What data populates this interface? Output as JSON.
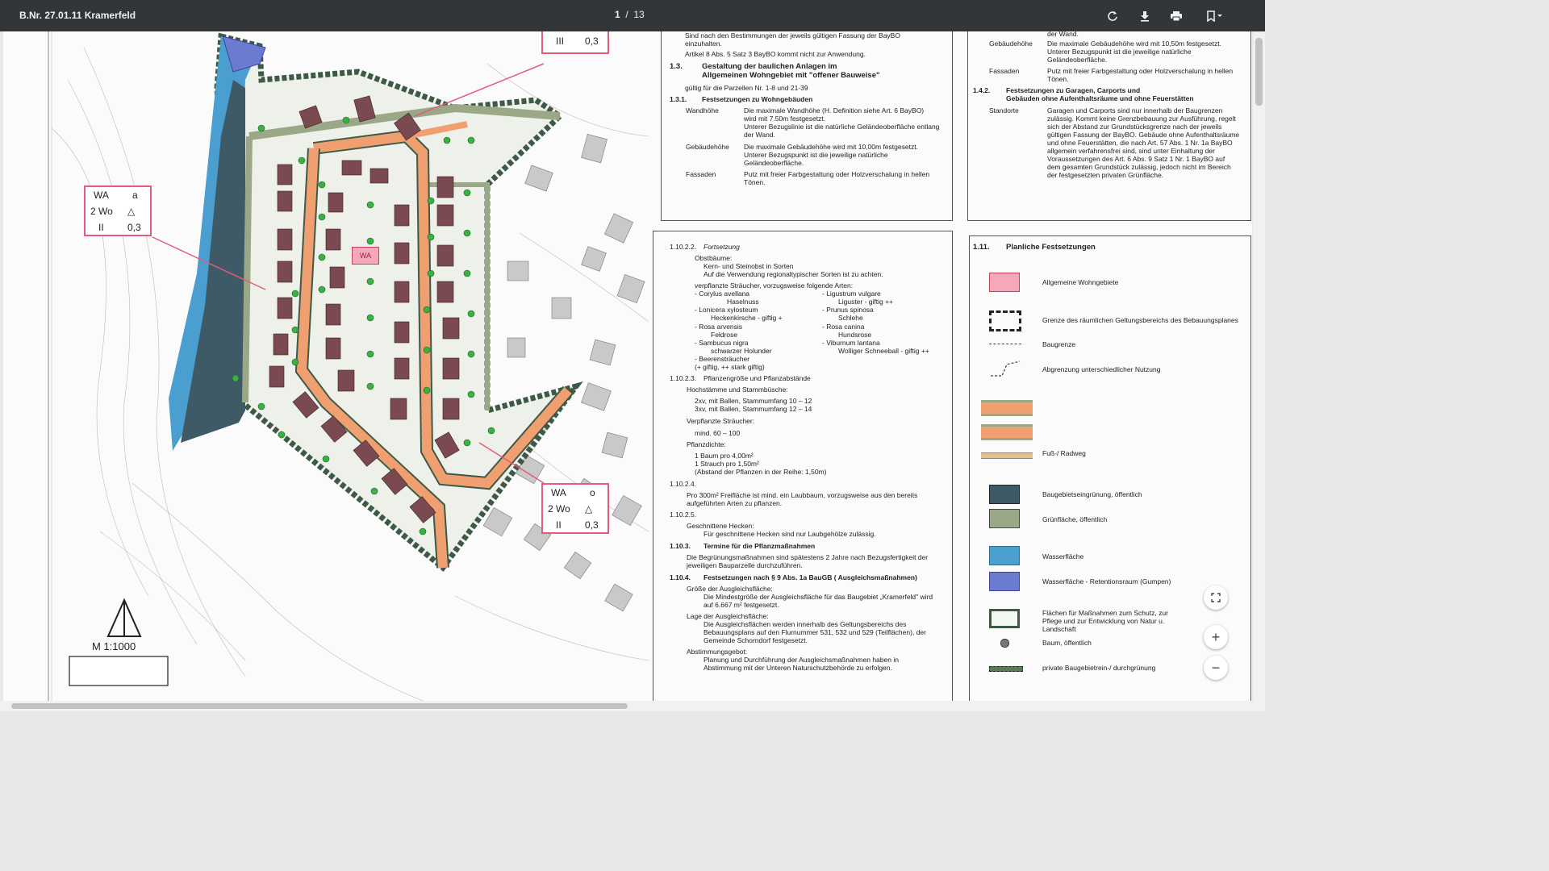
{
  "toolbar": {
    "title": "B.Nr. 27.01.11 Kramerfeld",
    "page_current": "1",
    "page_sep": "/",
    "page_total": "13",
    "icons": [
      "rotate-icon",
      "download-icon",
      "print-icon",
      "bookmark-icon"
    ]
  },
  "map": {
    "tables": [
      {
        "r1a": "WA",
        "r1b": "a",
        "r2a": "2 Wo",
        "r3a": "II",
        "r3b": "0,3"
      },
      {
        "r1a": "WA",
        "r1b": "o",
        "r2a": "2 Wo",
        "r3a": "II",
        "r3b": "0,3"
      },
      {
        "r3a": "III",
        "r3b": "0,3"
      }
    ],
    "scale": "M 1:1000",
    "center_label": "WA"
  },
  "text_top": {
    "l1": "Sind nach den Bestimmungen der jeweils gültigen Fassung der BayBO",
    "l2": "einzuhalten.",
    "l3": "Artikel 8 Abs. 5 Satz 3 BayBO kommt nicht zur Anwendung.",
    "h13_num": "1.3.",
    "h13_a": "Gestaltung der baulichen Anlagen im",
    "h13_b": "Allgemeinen Wohngebiet mit \"offener Bauweise\"",
    "gilt": "gültig für die Parzellen Nr. 1-8 und 21-39",
    "h131_num": "1.3.1.",
    "h131": "Festsetzungen zu Wohngebäuden",
    "wand_k": "Wandhöhe",
    "wand_1": "Die maximale Wandhöhe (H. Definition siehe Art. 6 BayBO)",
    "wand_2": "wird mit 7.50m festgesetzt.",
    "wand_3": "Unterer Bezugslinie ist die natürliche Geländeoberfläche entlang",
    "wand_4": "der Wand.",
    "geb_k": "Gebäudehöhe",
    "geb_1": "Die maximale Gebäudehöhe wird mit 10,00m festgesetzt.",
    "geb_2": "Unterer Bezugspunkt ist die jeweilige natürliche",
    "geb_3": "Geländeoberfläche.",
    "fas_k": "Fassaden",
    "fas_1": "Putz mit freier Farbgestaltung oder Holzverschalung in hellen",
    "fas_2": "Tönen."
  },
  "text_right_top": {
    "l0": "der Wand.",
    "geb_k": "Gebäudehöhe",
    "geb_1": "Die maximale Gebäudehöhe wird mit 10,50m festgesetzt.",
    "geb_2": "Unterer Bezugspunkt ist die jeweilige natürliche",
    "geb_3": "Geländeoberfläche.",
    "fas_k": "Fassaden",
    "fas_1": "Putz mit freier Farbgestaltung oder Holzverschalung in hellen",
    "fas_2": "Tönen.",
    "h142_num": "1.4.2.",
    "h142_a": "Festsetzungen zu Garagen, Carports und",
    "h142_b": "Gebäuden ohne Aufenthaltsräume und ohne Feuerstätten",
    "st_k": "Standorte",
    "st_1": "Garagen und Carports sind nur innerhalb der Baugrenzen",
    "st_2": "zulässig. Kommt keine Grenzbebauung zur Ausführung, regelt",
    "st_3": "sich der Abstand zur Grundstücksgrenze nach der jeweils",
    "st_4": "gültigen Fassung der BayBO. Gebäude ohne Aufenthaltsräume",
    "st_5": "und ohne Feuerstätten, die nach Art. 57 Abs. 1 Nr. 1a BayBO",
    "st_6": "allgemein verfahrensfrei sind, sind unter Einhaltung der",
    "st_7": "Voraussetzungen des Art. 6 Abs. 9 Satz 1 Nr. 1 BayBO auf",
    "st_8": "dem gesamten Grundstück zulässig, jedoch nicht im Bereich",
    "st_9": "der festgesetzten privaten Grünfläche."
  },
  "text_mid": {
    "h1_num": "1.10.2.2.",
    "h1": "Fortsetzung",
    "obst": "Obstbäume:",
    "obst_1": "Kern- und Steinobst in Sorten",
    "obst_2": "Auf die Verwendung regionaltypischer Sorten ist zu achten.",
    "str": "verpflanzte Sträucher, vorzugsweise folgende Arten:",
    "c1": "- Corylus avellana",
    "c1b": "Haselnuss",
    "c2": "- Lonicera xylosteum",
    "c2b": "Heckenkirsche - giftig +",
    "c3": "- Rosa arvensis",
    "c3b": "Feldrose",
    "c4": "- Sambucus nigra",
    "c4b": "schwarzer Holunder",
    "c5": "- Beerensträucher",
    "c5b": "(+ giftig, ++ stark giftig)",
    "d1": "- Ligustrum vulgare",
    "d1b": "Liguster - giftig ++",
    "d2": "- Prunus spinosa",
    "d2b": "Schlehe",
    "d3": "- Rosa canina",
    "d3b": "Hundsrose",
    "d4": "- Viburnum lantana",
    "d4b": "Wolliger Schneeball - giftig ++",
    "h2_num": "1.10.2.3.",
    "h2": "Pflanzengröße und Pflanzabstände",
    "hoch": "Hochstämme und Stammbüsche:",
    "hoch_1": "2xv, mit Ballen, Stammumfang 10 – 12",
    "hoch_2": "3xv, mit Ballen, Stammumfang 12 – 14",
    "verp": "Verpflanzte Sträucher:",
    "verp_1": "mind. 60 – 100",
    "dichte": "Pflanzdichte:",
    "dichte_1": "1 Baum pro 4,00m²",
    "dichte_2": "1 Strauch pro 1,50m²",
    "dichte_3": "(Abstand der Pflanzen in der Reihe: 1,50m)",
    "h3_num": "1.10.2.4.",
    "h3_1": "Pro 300m² Freifläche ist mind. ein Laubbaum, vorzugsweise aus den bereits",
    "h3_2": "aufgeführten Arten zu pflanzen.",
    "h4_num": "1.10.2.5.",
    "hecken": "Geschnittene Hecken:",
    "hecken_1": "Für geschnittene Hecken sind nur Laubgehölze zulässig.",
    "h5_num": "1.10.3.",
    "h5": "Termine für die Pflanzmaßnahmen",
    "t_1": "Die Begrünungsmaßnahmen sind spätestens 2 Jahre nach Bezugsfertigkeit der",
    "t_2": "jeweiligen Bauparzelle durchzuführen.",
    "h6_num": "1.10.4.",
    "h6": "Festsetzungen nach § 9 Abs. 1a BauGB ( Ausgleichsmaßnahmen)",
    "gr": "Größe der Ausgleichsfläche:",
    "gr_1": "Die Mindestgröße der Ausgleichsfläche für das Baugebiet „Kramerfeld\" wird",
    "gr_2": "auf 6.667 m² festgesetzt.",
    "lage": "Lage der Ausgleichsfläche:",
    "lage_1": "Die Ausgleichsflächen werden innerhalb des Geltungsbereichs des",
    "lage_2": "Bebauungsplans auf den Flurnummer 531, 532 und 529 (Teilflächen), der",
    "lage_3": "Gemeinde Schorndorf festgesetzt.",
    "abst": "Abstimmungsgebot:",
    "abst_1": "Planung und Durchführung der Ausgleichsmaßnahmen haben in",
    "abst_2": "Abstimmung mit der Unteren Naturschutzbehörde zu erfolgen."
  },
  "legend": {
    "h_num": "1.11.",
    "h": "Planliche Festsetzungen",
    "items": [
      "Allgemeine Wohngebiete",
      "Grenze des räumlichen Geltungsbereichs des Bebauungsplanes",
      "Baugrenze",
      "Abgrenzung unterschiedlicher Nutzung",
      "Fuß-/ Radweg",
      "Baugebietseingrünung, öffentlich",
      "Grünfläche, öffentlich",
      "Wasserfläche",
      "Wasserfläche - Retentionsraum (Gumpen)",
      "Flächen für Maßnahmen zum Schutz, zur Pflege und zur Entwicklung von Natur u. Landschaft",
      "Baum, öffentlich",
      "private Baugebietrein-/ durchgrünung"
    ]
  },
  "colors": {
    "toolbar": "#323639",
    "road": "#f0a070",
    "green": "#9aa887",
    "water": "#4a9ed0",
    "dark_green": "#3e5a66",
    "house": "#7a4a50",
    "pink": "#e55b7a"
  }
}
